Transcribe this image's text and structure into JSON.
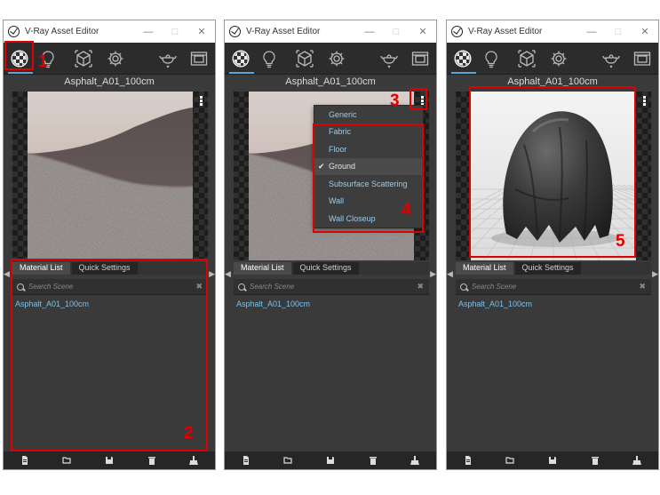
{
  "windows": [
    {
      "title": "V-Ray Asset Editor",
      "material_name": "Asphalt_A01_100cm",
      "tabs": [
        "Material List",
        "Quick Settings"
      ],
      "search_placeholder": "Search Scene",
      "list": [
        "Asphalt_A01_100cm"
      ],
      "preview": "asphalt",
      "callouts": [
        "1",
        "2"
      ]
    },
    {
      "title": "V-Ray Asset Editor",
      "material_name": "Asphalt_A01_100cm",
      "tabs": [
        "Material List",
        "Quick Settings"
      ],
      "search_placeholder": "Search Scene",
      "list": [
        "Asphalt_A01_100cm"
      ],
      "preview": "asphalt",
      "callouts": [
        "3",
        "4"
      ],
      "dropdown": {
        "items": [
          "Generic",
          "Fabric",
          "Floor",
          "Ground",
          "Subsurface Scattering",
          "Wall",
          "Wall Closeup"
        ],
        "selected": "Ground"
      }
    },
    {
      "title": "V-Ray Asset Editor",
      "material_name": "Asphalt_A01_100cm",
      "tabs": [
        "Material List",
        "Quick Settings"
      ],
      "search_placeholder": "Search Scene",
      "list": [
        "Asphalt_A01_100cm"
      ],
      "preview": "fabric",
      "callouts": [
        "5"
      ]
    }
  ],
  "window_buttons": [
    "—",
    "□",
    "✕"
  ],
  "toolbar_icons": [
    "materials-icon",
    "lights-icon",
    "geometry-icon",
    "settings-icon",
    "render-teapot-icon",
    "frame-buffer-icon"
  ],
  "bottombar_icons": [
    "new-file-icon",
    "open-folder-icon",
    "save-icon",
    "delete-icon",
    "clean-up-icon"
  ],
  "colors": {
    "highlight": "#e00000",
    "accent": "#5aa6d6",
    "list_text": "#7fc0e8"
  }
}
